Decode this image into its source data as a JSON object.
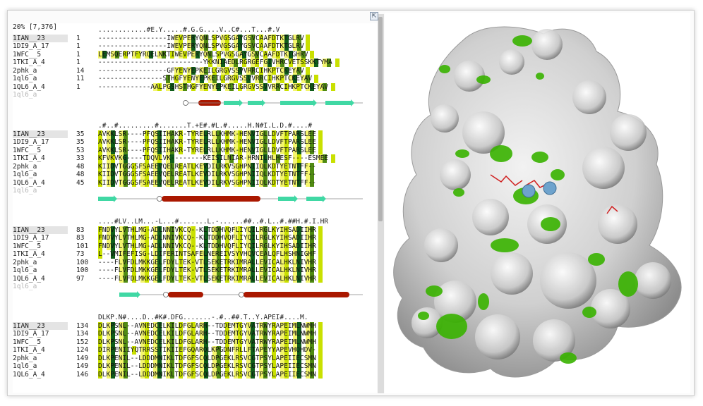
{
  "header": {
    "status": "20% [7,376]"
  },
  "blocks": [
    {
      "cons": "............#E.Y.....#.G.G....V..C#...T...#.V",
      "rows": [
        {
          "name": "1IAN__23",
          "num": "1",
          "seq": "-----------------IWEVPERYQNLSPVGSGAYGSVCAAFDTKTGLRV"
        },
        {
          "name": "1DI9_A_17",
          "num": "1",
          "seq": "-----------------IWEVPERYQNLSPVGSGAYGSVCAAFDTKTGLRV"
        },
        {
          "name": "1WFC__5",
          "num": "1",
          "seq": "LEMSQERPTFYRQELNKTIWEVPERYQNLSPVGSGAYGSVCAAFDTKTGHRV"
        },
        {
          "name": "1TKI_A_4",
          "num": "1",
          "seq": "--------------------------YKKNIAEDLRGRGEFGIVHRCVETSSKKTYMA"
        },
        {
          "name": "2phk_a",
          "num": "14",
          "seq": "-----------------GFYENYEPKEILGRGVSSVVRRCIHKPTCKEYAV"
        },
        {
          "name": "1ql6_a",
          "num": "11",
          "seq": "----------------STHGFYENYEPKEILGRGVSSVVRRCIHKPTCKEYAV"
        },
        {
          "name": "1QL6_A_4",
          "num": "1",
          "seq": "-------------AALPGSHSTHGFYENYEPKEILGRGVSSVVRRCIHKPTCKEYAV"
        },
        {
          "name": "1ql6_a",
          "num": "",
          "seq": "",
          "ghost": true
        }
      ]
    },
    {
      "cons": ".#..#.........#.......T.+E#.#L.#.....H.N#I.L.D.#....#",
      "rows": [
        {
          "name": "1IAN__23",
          "num": "35",
          "seq": "AVKKLSR----PFQSIIHAKR-TYRELRLLKHMK-HENVIGLLDVFTPARSLEE"
        },
        {
          "name": "1DI9_A_17",
          "num": "35",
          "seq": "AVKKLSR----PFQSIIHAKR-TYRELRLLKHMK-HENVIGLLDVFTPARSLEE"
        },
        {
          "name": "1WFC__5",
          "num": "53",
          "seq": "AVKKLSR----PFQSIIHAKR-TYRELRLLKHMK-HENVIGLLDVFTPARSLEE"
        },
        {
          "name": "1TKI_A_4",
          "num": "33",
          "seq": "KFVKVKG----TDQVLVK--------KEISILNIAR-HRNILHLHESF----ESMEE"
        },
        {
          "name": "2phk_a",
          "num": "48",
          "seq": "KIIDVTGGGSFSAEEVQELREATLKEVDILRKVSGHPNIIQLKDTYETNTFF--"
        },
        {
          "name": "1ql6_a",
          "num": "48",
          "seq": "KIIDVTGGGSFSAEEVQELREATLKEVDILRKVSGHPNIIQLKDTYETNTFF--"
        },
        {
          "name": "1QL6_A_4",
          "num": "45",
          "seq": "KIIDVTGGGSFSAEEVQELREATLKEVDILRKVSGHPNIIQLKDTYETNTFF--"
        },
        {
          "name": "1ql6_a",
          "num": "",
          "seq": "",
          "ghost": true
        }
      ]
    },
    {
      "cons": "....#LV..LM...-L...#.......L.-......##..#.L..#.##H.#.I.HR",
      "rows": [
        {
          "name": "1IAN__23",
          "num": "83",
          "seq": "FNDVYLVTHLMG-ADLNNIVKCQ--KLTDDHVQFLIYQILRGLKYIHSADIIHR"
        },
        {
          "name": "1DI9_A_17",
          "num": "83",
          "seq": "FNDVYLVTHLMG-ADLNNIVKCQ--KLTDDHVQFLIYQILRGLKYIHSADIIHR"
        },
        {
          "name": "1WFC__5",
          "num": "101",
          "seq": "FNDVYLVTHLMG-ADLNNIVKCQ--KLTDDHVQFLIYQILRGLKYIHSADIIHR"
        },
        {
          "name": "1TKI_A_4",
          "num": "73",
          "seq": "L--VMIFEFISG-LDIFERINTSAFELNEREIVSYVHQVCEALQFLHSHNIGHF"
        },
        {
          "name": "2phk_a",
          "num": "100",
          "seq": "----FLVFDLMKKGELFDYLTEK-VTLSEKETRKIMRALLEVICALHKLNIVHR"
        },
        {
          "name": "1ql6_a",
          "num": "100",
          "seq": "----FLVFDLMKKGELFDYLTEK-VTLSEKETRKIMRALLEVICALHKLNIVHR"
        },
        {
          "name": "1QL6_A_4",
          "num": "97",
          "seq": "----FLVFDLMKKGELFDYLTEK-VTLSEKETRKIMRALLEVICALHKLNIVHR"
        },
        {
          "name": "1ql6_a",
          "num": "",
          "seq": "",
          "ghost": true
        }
      ]
    },
    {
      "cons": "DLKP.N#....D..#K#.DFG.......-.#..##.T..Y.APEI#....M.",
      "rows": [
        {
          "name": "1IAN__23",
          "num": "134",
          "seq": "DLKPSNL--AVNEDCELKILDFGLARH--TDDEMTGYVATRWYRAPEIMLNWMH"
        },
        {
          "name": "1DI9_A_17",
          "num": "134",
          "seq": "DLKPSNL--AVNEDCELKILDFGLARH--TDDEMTGYVATRWYRAPEIMLNWMH"
        },
        {
          "name": "1WFC__5",
          "num": "152",
          "seq": "DLKPSNL--AVNEDCELKILDFGLARH--TDDEMTGYVATRWYRAPEIMLNWMH"
        },
        {
          "name": "1TKI_A_4",
          "num": "124",
          "seq": "DIRPENIIYQTRRSSTIKIIEFGQARQLKPGDNFRLLFTAPEYYAPEVHQHDV-"
        },
        {
          "name": "2phk_a",
          "num": "149",
          "seq": "DLKPENIL--LDDDMNIKLTDFGFSCQLDPGEKLRSVCGTPSYLAPEIIECSMN"
        },
        {
          "name": "1ql6_a",
          "num": "149",
          "seq": "DLKPENIL--LDDDMNIKLTDFGFSCQLDPGEKLRSVCGTPSYLAPEIIECSMN"
        },
        {
          "name": "1QL6_A_4",
          "num": "146",
          "seq": "DLKPENIL--LDDDMNIKLTDFGFSCQLDPGEKLRSVCGTPSYLAPEIIECSMN"
        }
      ]
    }
  ],
  "colors": {
    "strong": "#0f5d1a",
    "mid": "#4f8a12",
    "light": "#c9e000",
    "pale": "#f4f56c",
    "helix": "#aa1800",
    "strand": "#40d8a4",
    "surface": "#d4d4d4",
    "green_patch": "#39b300"
  }
}
